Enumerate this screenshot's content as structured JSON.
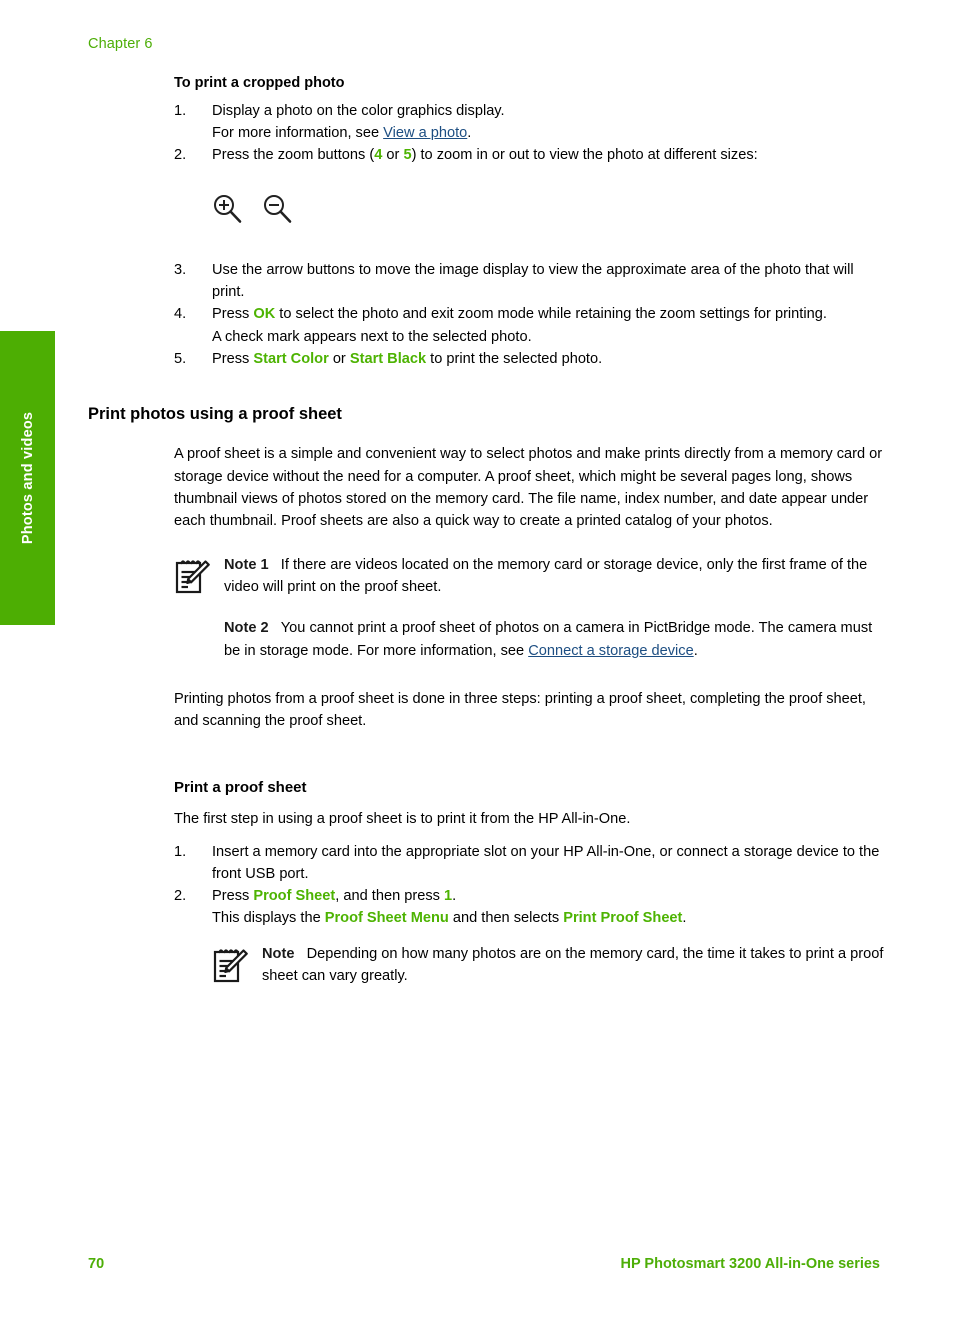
{
  "page": {
    "chapter_label": "Chapter 6",
    "side_tab_label": "Photos and videos",
    "footer_page_number": "70",
    "footer_product": "HP Photosmart 3200 All-in-One series",
    "accent_green": "#4DB302",
    "tab_green": "#4DAE03",
    "link_blue": "#1D4E82"
  },
  "cropped_photo": {
    "heading": "To print a cropped photo",
    "steps": [
      {
        "num": "1.",
        "line1": "Display a photo on the color graphics display.",
        "line2_pre": "For more information, see ",
        "line2_link": "View a photo",
        "line2_post": "."
      },
      {
        "num": "2.",
        "pre": "Press the zoom buttons (",
        "key1": "4",
        "mid": " or ",
        "key2": "5",
        "post": ") to zoom in or out to view the photo at different sizes:"
      },
      {
        "num": "3.",
        "text": "Use the arrow buttons to move the image display to view the approximate area of the photo that will print."
      },
      {
        "num": "4.",
        "pre": "Press ",
        "key": "OK",
        "post": " to select the photo and exit zoom mode while retaining the zoom settings for printing.",
        "sub": "A check mark appears next to the selected photo."
      },
      {
        "num": "5.",
        "pre": "Press ",
        "key1": "Start Color",
        "mid": " or ",
        "key2": "Start Black",
        "post": " to print the selected photo."
      }
    ],
    "zoom_in_icon": "zoom-in-magnifier-icon",
    "zoom_out_icon": "zoom-out-magnifier-icon"
  },
  "proof_sheet_section": {
    "heading": "Print photos using a proof sheet",
    "intro": "A proof sheet is a simple and convenient way to select photos and make prints directly from a memory card or storage device without the need for a computer. A proof sheet, which might be several pages long, shows thumbnail views of photos stored on the memory card. The file name, index number, and date appear under each thumbnail. Proof sheets are also a quick way to create a printed catalog of your photos.",
    "note1": {
      "label": "Note 1",
      "text": "If there are videos located on the memory card or storage device, only the first frame of the video will print on the proof sheet."
    },
    "note2": {
      "label": "Note 2",
      "text_pre": "You cannot print a proof sheet of photos on a camera in PictBridge mode. The camera must be in storage mode. For more information, see ",
      "link": "Connect a storage device",
      "text_post": "."
    },
    "after_notes": "Printing photos from a proof sheet is done in three steps: printing a proof sheet, completing the proof sheet, and scanning the proof sheet."
  },
  "print_proof_sheet": {
    "heading": "Print a proof sheet",
    "intro": "The first step in using a proof sheet is to print it from the HP All-in-One.",
    "steps": [
      {
        "num": "1.",
        "text": "Insert a memory card into the appropriate slot on your HP All-in-One, or connect a storage device to the front USB port."
      },
      {
        "num": "2.",
        "pre": "Press ",
        "key1": "Proof Sheet",
        "mid": ", and then press ",
        "key2": "1",
        "post": ".",
        "sub_pre": "This displays the ",
        "sub_key1": "Proof Sheet Menu",
        "sub_mid": " and then selects ",
        "sub_key2": "Print Proof Sheet",
        "sub_post": "."
      }
    ],
    "note": {
      "label": "Note",
      "text": "Depending on how many photos are on the memory card, the time it takes to print a proof sheet can vary greatly."
    }
  }
}
